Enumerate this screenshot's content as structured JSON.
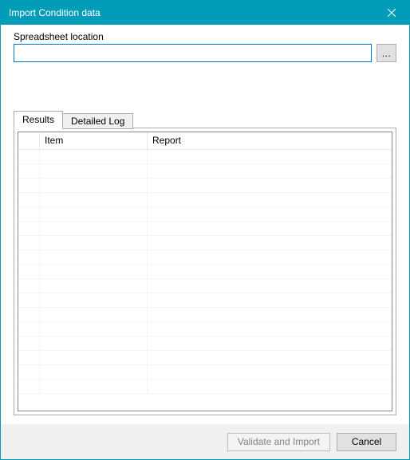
{
  "window": {
    "title": "Import Condition data"
  },
  "location": {
    "label": "Spreadsheet location",
    "value": "",
    "browse_label": "..."
  },
  "tabs": {
    "results": {
      "label": "Results"
    },
    "detailed_log": {
      "label": "Detailed Log"
    }
  },
  "grid": {
    "columns": {
      "item": "Item",
      "report": "Report"
    },
    "rows": []
  },
  "footer": {
    "validate_label": "Validate and Import",
    "cancel_label": "Cancel"
  }
}
